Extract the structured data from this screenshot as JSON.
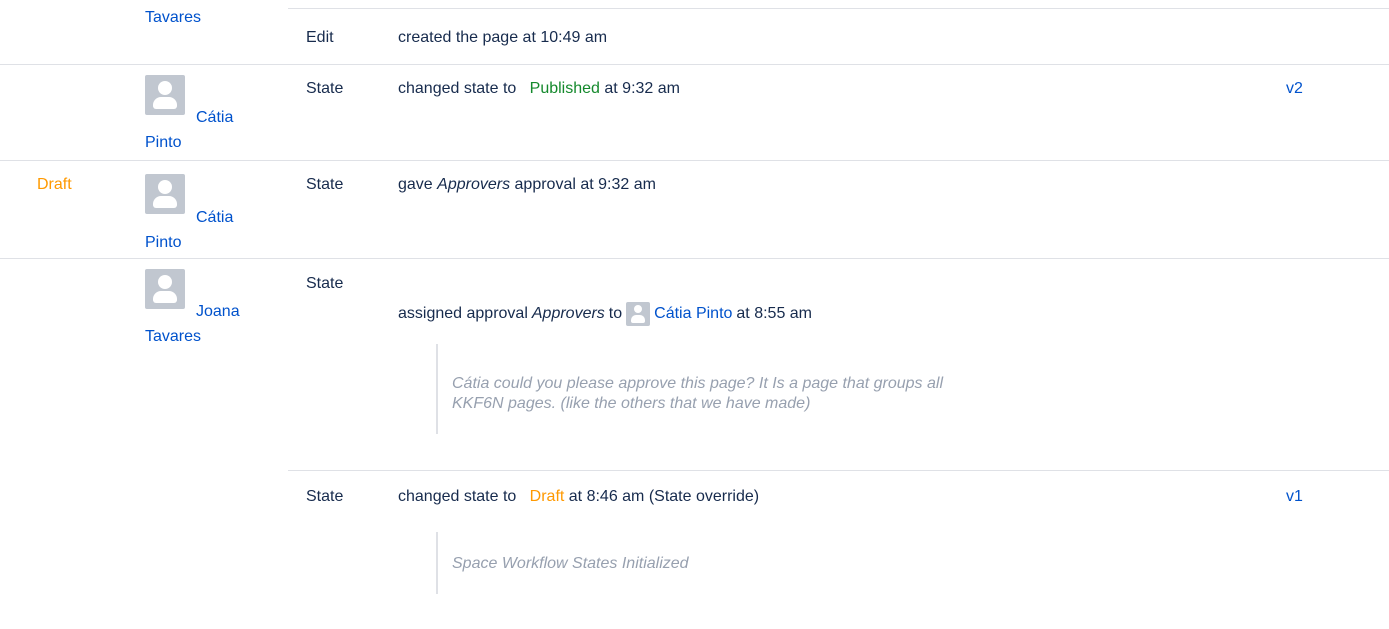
{
  "rows": [
    {
      "user": "Tavares",
      "type": "Edit",
      "text": "created the page at 10:49 am"
    },
    {
      "user_first": "Cátia",
      "user_last": "Pinto",
      "type": "State",
      "pre": "changed state to",
      "state": "Published",
      "post": "at 9:32 am",
      "version": "v2",
      "state_color": "#14892c"
    },
    {
      "left_state": "Draft",
      "user_first": "Cátia",
      "user_last": "Pinto",
      "type": "State",
      "pre": "gave",
      "italic": "Approvers",
      "post": "approval at 9:32 am"
    },
    {
      "user_first": "Joana",
      "user_last": "Tavares",
      "type": "State",
      "pre": "assigned approval",
      "italic": "Approvers",
      "mid": "to",
      "assignee": "Cátia Pinto",
      "post": "at 8:55 am",
      "comment_line1": "Cátia could you please approve this page? It Is a page that groups all",
      "comment_line2": "KKF6N pages. (like the others that we have made)"
    },
    {
      "type": "State",
      "pre": "changed state to",
      "state": "Draft",
      "post": "at 8:46 am (State override)",
      "version": "v1",
      "comment": "Space Workflow States Initialized",
      "state_color": "#ff9900"
    }
  ],
  "colors": {
    "link": "#0052cc",
    "draft": "#ff9900",
    "published": "#14892c",
    "divider": "#dfe1e6",
    "comment": "#97a0af"
  },
  "icons": {
    "avatar": "default-user-avatar-icon"
  }
}
